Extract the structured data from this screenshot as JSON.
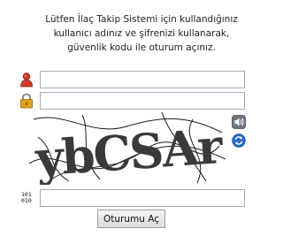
{
  "intro": {
    "line1": "Lütfen İlaç Takip Sistemi için kullandığınız",
    "line2": "kullanıcı adınız ve şifrenizi kullanarak,",
    "line3": "güvenlik kodu ile oturum açınız."
  },
  "form": {
    "username_value": "",
    "password_value": "",
    "captcha_value": "",
    "captcha_text": "ybCSAr",
    "code_icon_top": "101",
    "code_icon_bottom": "010",
    "submit_label": "Oturumu Aç"
  },
  "icons": {
    "username": "user-icon",
    "password": "lock-icon",
    "audio": "speaker-icon",
    "refresh": "refresh-icon",
    "code": "binary-code-icon"
  },
  "colors": {
    "user_icon": "#d23a2a",
    "lock_icon": "#e0a21a",
    "field_border": "#a5acb5",
    "side_icon_blue": "#2a6cc4"
  }
}
